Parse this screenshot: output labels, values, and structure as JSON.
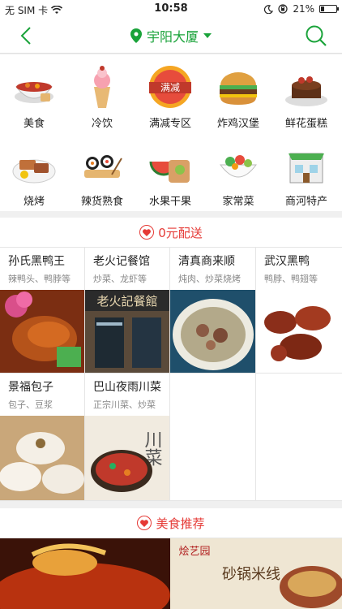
{
  "status": {
    "carrier": "无 SIM 卡",
    "time": "10:58",
    "battery": "21%",
    "battery_level": 0.21
  },
  "header": {
    "location": "宇阳大厦"
  },
  "categories": [
    {
      "label": "美食",
      "icon": "food-bowl-icon"
    },
    {
      "label": "冷饮",
      "icon": "ice-cream-icon"
    },
    {
      "label": "满减专区",
      "icon": "discount-badge-icon",
      "badge_text": "满减"
    },
    {
      "label": "炸鸡汉堡",
      "icon": "burger-icon"
    },
    {
      "label": "鲜花蛋糕",
      "icon": "cake-icon"
    },
    {
      "label": "烧烤",
      "icon": "bbq-plate-icon"
    },
    {
      "label": "辣货熟食",
      "icon": "sushi-icon"
    },
    {
      "label": "水果干果",
      "icon": "fruit-icon"
    },
    {
      "label": "家常菜",
      "icon": "salad-bowl-icon"
    },
    {
      "label": "商河特产",
      "icon": "shop-front-icon"
    }
  ],
  "free_delivery": {
    "title": "0元配送",
    "shops": [
      {
        "name": "孙氏黑鸭王",
        "tags": "辣鸭头、鸭脖等"
      },
      {
        "name": "老火记餐馆",
        "tags": "炒菜、龙虾等"
      },
      {
        "name": "清真商来顺",
        "tags": "炖肉、炒菜烧烤"
      },
      {
        "name": "武汉黑鸭",
        "tags": "鸭脖、鸭翅等"
      },
      {
        "name": "景福包子",
        "tags": "包子、豆浆"
      },
      {
        "name": "巴山夜雨川菜",
        "tags": "正宗川菜、炒菜"
      }
    ],
    "photo_texts": {
      "restaurant_sign": "老火記餐館",
      "sichuan_calligraphy": "川菜"
    }
  },
  "recommend": {
    "title": "美食推荐",
    "banner_texts": {
      "brand": "烩艺园",
      "dish": "砂锅米线"
    }
  },
  "colors": {
    "accent_green": "#1aa33a",
    "accent_red": "#e53935"
  }
}
